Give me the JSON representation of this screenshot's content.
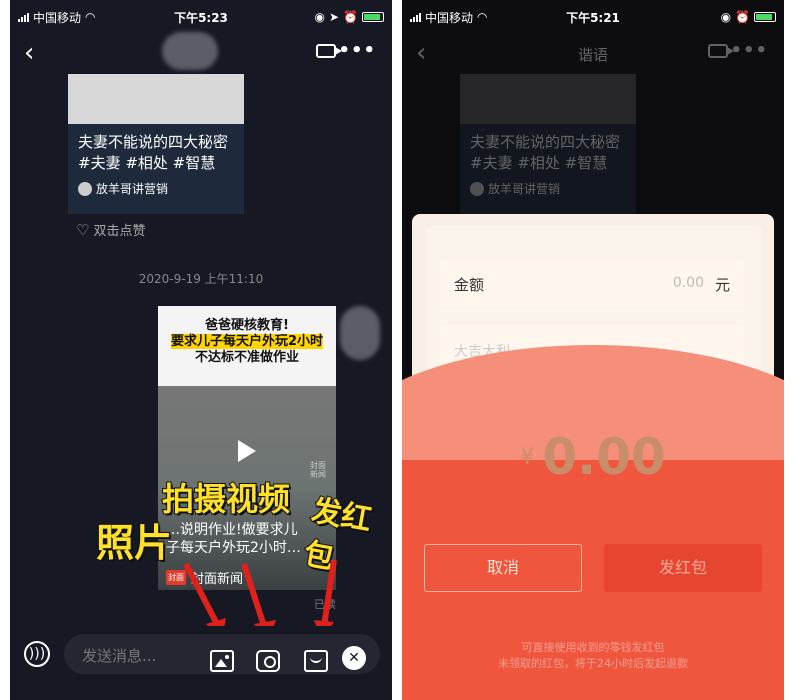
{
  "left": {
    "status": {
      "carrier": "中国移动",
      "time": "下午5:23"
    },
    "card": {
      "title_line1": "夫妻不能说的四大秘密",
      "title_line2": "#夫妻 #相处 #智慧",
      "author": "放羊哥讲营销"
    },
    "like_label": "双击点赞",
    "timestamp": "2020-9-19 上午11:10",
    "video": {
      "headline1": "爸爸硬核教育!",
      "headline2": "要求儿子每天户外玩2小时",
      "headline3": "不达标不准做作业",
      "caption_line1": "…说明作业!做要求儿",
      "caption_line2": "子每天户外玩2小时…",
      "source": "封面新闻",
      "source_logo": "封面",
      "watermark": "封面\n新闻"
    },
    "read_label": "已读",
    "overlay": {
      "video": "拍摄视频",
      "red_packet": "发红包",
      "photo": "照片"
    },
    "input_placeholder": "发送消息...",
    "icons": [
      "voice-icon",
      "image-icon",
      "camera-icon",
      "red-packet-icon",
      "close-icon"
    ]
  },
  "right": {
    "status": {
      "carrier": "中国移动",
      "time": "下午5:21"
    },
    "nav_title": "谐语",
    "card": {
      "title_line1": "夫妻不能说的四大秘密",
      "title_line2": "#夫妻 #相处 #智慧",
      "author": "放羊哥讲营销"
    },
    "amount_label": "金额",
    "amount_value": "0.00",
    "amount_unit": "元",
    "message_placeholder": "大吉大利",
    "currency": "¥",
    "total": "0.00",
    "cancel_label": "取消",
    "send_label": "发红包",
    "footnote_line1": "可直接使用收到的零钱发红包",
    "footnote_line2": "未领取的红包，将于24小时后发起退款"
  }
}
